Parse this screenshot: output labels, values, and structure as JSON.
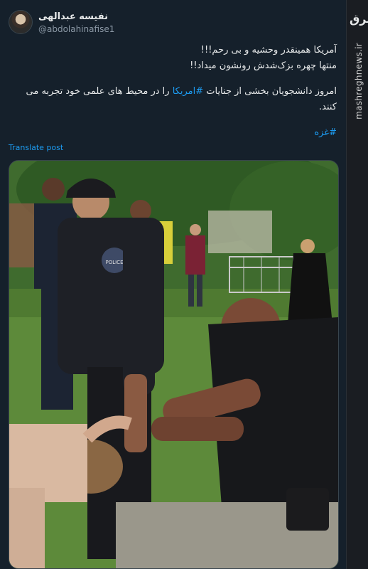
{
  "author": {
    "display_name": "نفیسه عبدالهی",
    "handle": "@abdolahinafise1"
  },
  "post": {
    "line1": "آمریکا همینقدر وحشیه و بی رحم!!!",
    "line2": "منتها چهره بزک‌شدش رونشون میداد!!",
    "line3_before": "امروز  دانشجویان بخشی از جنایات ",
    "line3_tag": "#امریکا",
    "line3_after": " را در محیط های علمی خود تجربه می کنند.",
    "hashtag": "#غزه"
  },
  "translate_label": "Translate post",
  "watermark": {
    "logo": "مشرق",
    "site": "mashreghnews.ir"
  },
  "media": {
    "badge_text": "POLICE"
  },
  "colors": {
    "background": "#15202b",
    "link": "#1d9bf0",
    "muted": "#8b98a5"
  }
}
